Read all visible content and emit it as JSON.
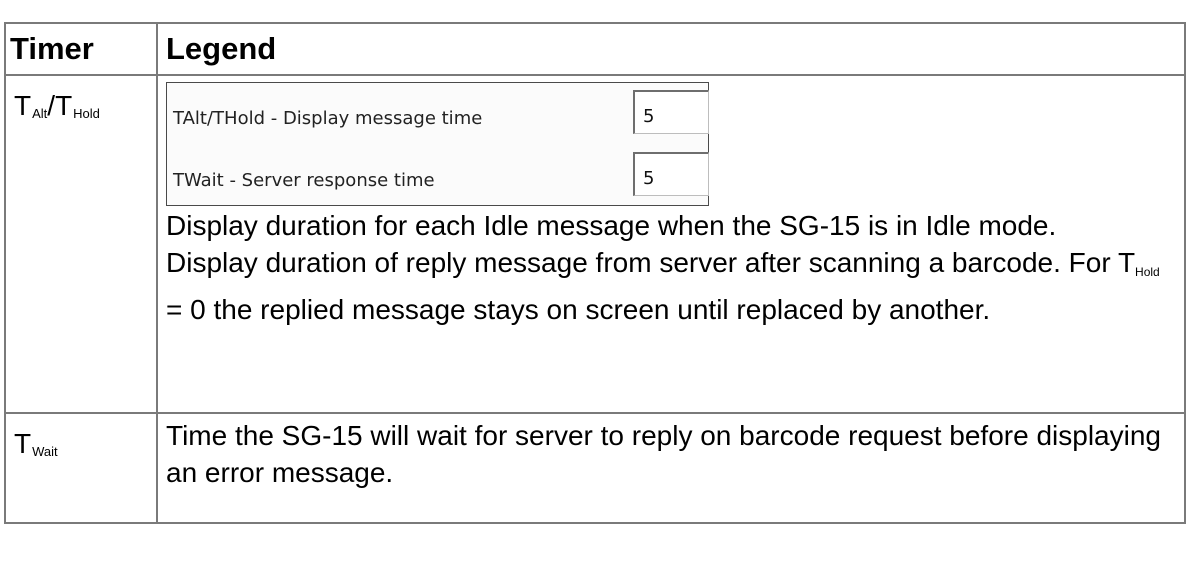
{
  "header": {
    "timer": "Timer",
    "legend": "Legend"
  },
  "row1": {
    "timer": {
      "t1": "T",
      "t1_sub": "Alt",
      "sep": "/",
      "t2": "T",
      "t2_sub": "Hold"
    },
    "panel": {
      "field1_label": "TAlt/THold - Display message time",
      "field1_value": "5",
      "field2_label": "TWait - Server response time",
      "field2_value": "5"
    },
    "para1": "Display duration for each Idle message when the SG-15 is in Idle mode.",
    "para2_a": "Display duration of reply message from server after scanning a barcode. For ",
    "para2_t": "T",
    "para2_sub": "Hold",
    "para2_b": " = 0 the replied message stays on screen until replaced by another."
  },
  "row2": {
    "timer": {
      "t": "T",
      "sub": "Wait"
    },
    "text": "Time the SG-15 will wait for server to reply on barcode request before displaying an error message."
  }
}
